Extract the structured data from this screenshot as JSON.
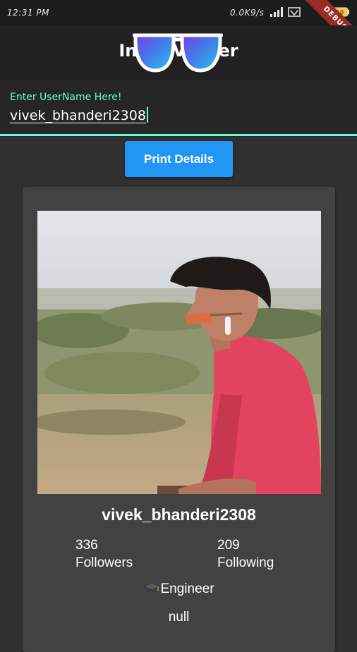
{
  "status_bar": {
    "time": "12:31 PM",
    "network_speed": "0.0K9/s",
    "battery_level": "50",
    "debug_label": "DEBUG"
  },
  "app_bar": {
    "title": "Insta Viewer",
    "logo_icon": "sunglasses-icon",
    "logo_gradient": [
      "#7b3fe4",
      "#3f7fe8",
      "#2ec6f0"
    ]
  },
  "search": {
    "label": "Enter UserName Here!",
    "value": "vivek_bhanderi2308"
  },
  "action": {
    "print_label": "Print Details"
  },
  "profile": {
    "photo_description": "profile-photo",
    "username": "vivek_bhanderi2308",
    "followers_count": "336",
    "followers_label": "Followers",
    "following_count": "209",
    "following_label": "Following",
    "bio_icon": "graduation-cap-icon",
    "bio": "Engineer",
    "location": "null"
  },
  "colors": {
    "accent": "#64ffda",
    "button": "#2196f3",
    "card": "#424242",
    "background": "#303030",
    "app_bar": "#212121"
  }
}
